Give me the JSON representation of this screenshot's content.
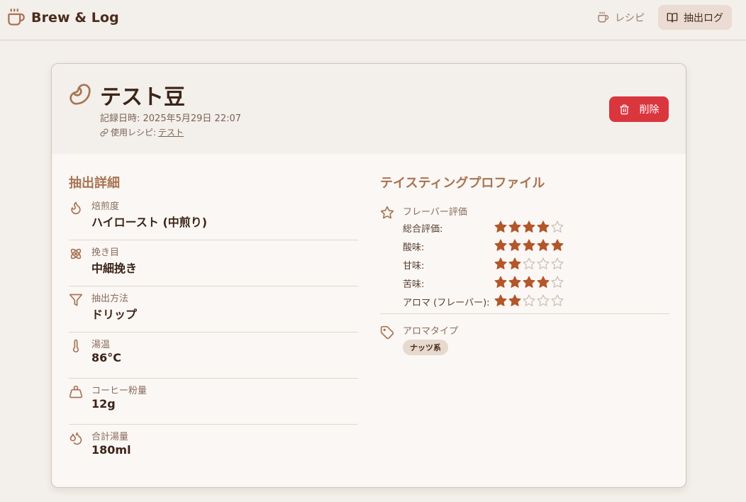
{
  "app": {
    "title": "Brew & Log"
  },
  "nav": {
    "recipe": "レシピ",
    "log": "抽出ログ"
  },
  "log": {
    "title": "テスト豆",
    "recorded_at": "記録日時: 2025年5月29日 22:07",
    "recipe_prefix": "使用レシピ:",
    "recipe_name": "テスト",
    "delete_label": "削除"
  },
  "details": {
    "title": "抽出詳細",
    "items": [
      {
        "icon": "flame-icon",
        "label": "焙煎度",
        "value": "ハイロースト (中煎り)"
      },
      {
        "icon": "grind-icon",
        "label": "挽き目",
        "value": "中細挽き"
      },
      {
        "icon": "filter-icon",
        "label": "抽出方法",
        "value": "ドリップ"
      },
      {
        "icon": "thermometer-icon",
        "label": "湯温",
        "value": "86°C"
      },
      {
        "icon": "weight-icon",
        "label": "コーヒー粉量",
        "value": "12g"
      },
      {
        "icon": "droplets-icon",
        "label": "合計湯量",
        "value": "180ml"
      }
    ]
  },
  "tasting": {
    "title": "テイスティングプロファイル",
    "flavor_header": "フレーバー評価",
    "max_rating": 5,
    "ratings": [
      {
        "label": "総合評価:",
        "value": 4
      },
      {
        "label": "酸味:",
        "value": 5
      },
      {
        "label": "甘味:",
        "value": 2
      },
      {
        "label": "苦味:",
        "value": 4
      },
      {
        "label": "アロマ (フレーバー):",
        "value": 2
      }
    ],
    "aroma_label": "アロマタイプ",
    "aroma_tags": [
      "ナッツ系"
    ]
  },
  "colors": {
    "accent": "#a87453",
    "star_filled": "#b3562a",
    "star_empty": "#cbbfb6",
    "delete": "#d9363e",
    "background": "#f3efea",
    "card": "#faf7f4"
  }
}
